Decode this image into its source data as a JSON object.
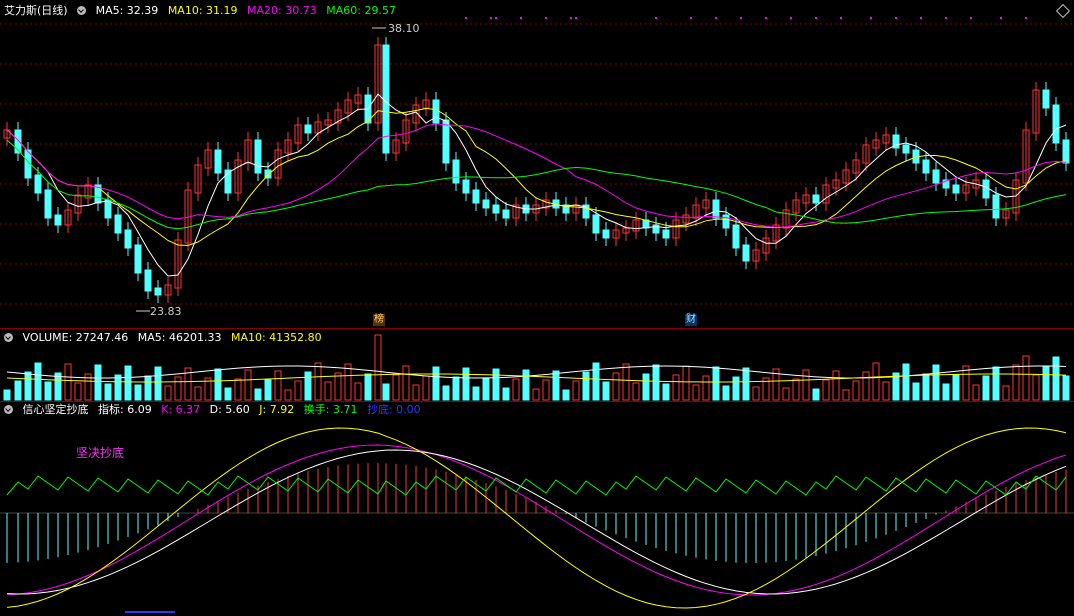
{
  "price_panel": {
    "stock_name": "艾力斯(日线)",
    "ma5": "MA5: 32.39",
    "ma10": "MA10: 31.19",
    "ma20": "MA20: 30.73",
    "ma60": "MA60: 29.57",
    "high_label": "38.10",
    "low_label": "23.83",
    "event_tag_1": "榜",
    "event_tag_2": "财"
  },
  "volume_panel": {
    "title": "VOLUME: 27247.46",
    "ma5": "MA5: 46201.33",
    "ma10": "MA10: 41352.80"
  },
  "indicator_panel": {
    "name": "信心坚定抄底",
    "index": "指标: 6.09",
    "k": "K: 6.37",
    "d": "D: 5.60",
    "j": "J: 7.92",
    "turnover": "换手: 3.71",
    "bottom": "抄底: 0.00",
    "signal_text": "坚决抄底"
  },
  "colors": {
    "up": "#ff3232",
    "down": "#54ffff",
    "ma5": "#ffffff",
    "ma10": "#ffff00",
    "ma20": "#ff00ff",
    "ma60": "#00ff00",
    "grid": "#8a0000"
  },
  "chart_data": [
    {
      "type": "candlestick",
      "ylim": [
        23.83,
        38.1
      ],
      "count": 100,
      "markers": {
        "high": 38.1,
        "low": 23.83
      }
    },
    {
      "type": "bar",
      "series": [
        "VOLUME",
        "MA5",
        "MA10"
      ]
    },
    {
      "type": "line",
      "series": [
        "K",
        "D",
        "J",
        "换手"
      ]
    }
  ]
}
